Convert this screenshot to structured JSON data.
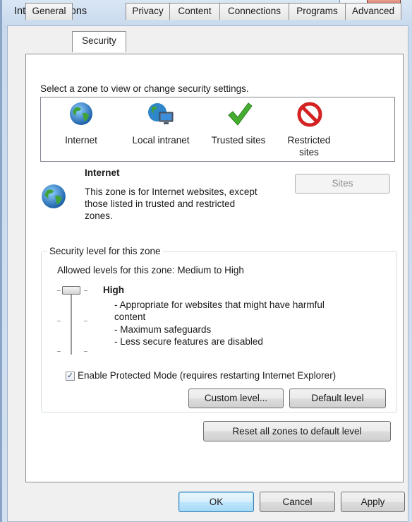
{
  "window": {
    "title": "Internet Options",
    "help_glyph": "?",
    "close_glyph": "x"
  },
  "tabs": [
    {
      "label": "General"
    },
    {
      "label": "Security"
    },
    {
      "label": "Privacy"
    },
    {
      "label": "Content"
    },
    {
      "label": "Connections"
    },
    {
      "label": "Programs"
    },
    {
      "label": "Advanced"
    }
  ],
  "active_tab": "Security",
  "security": {
    "zone_prompt": "Select a zone to view or change security settings.",
    "zones": [
      {
        "label": "Internet",
        "icon": "globe-icon"
      },
      {
        "label": "Local intranet",
        "icon": "intranet-icon"
      },
      {
        "label": "Trusted sites",
        "icon": "checkmark-icon"
      },
      {
        "label": "Restricted sites",
        "icon": "restricted-icon"
      }
    ],
    "selected_zone": {
      "name": "Internet",
      "description": "This zone is for Internet websites, except those listed in trusted and restricted zones."
    },
    "sites_button": "Sites",
    "level_group_title": "Security level for this zone",
    "allowed_levels": "Allowed levels for this zone: Medium to High",
    "level_name": "High",
    "level_details": [
      "- Appropriate for websites that might have harmful",
      "content",
      "- Maximum safeguards",
      "- Less secure features are disabled"
    ],
    "protected_mode_label": "Enable Protected Mode (requires restarting Internet Explorer)",
    "protected_mode_checked": true,
    "custom_level_button": "Custom level...",
    "default_level_button": "Default level",
    "reset_button": "Reset all zones to default level"
  },
  "footer": {
    "ok": "OK",
    "cancel": "Cancel",
    "apply": "Apply"
  },
  "colors": {
    "globe": "#2f86c8",
    "check": "#3fa32a",
    "restricted": "#d42222",
    "default_button_border": "#3c7fb1"
  }
}
